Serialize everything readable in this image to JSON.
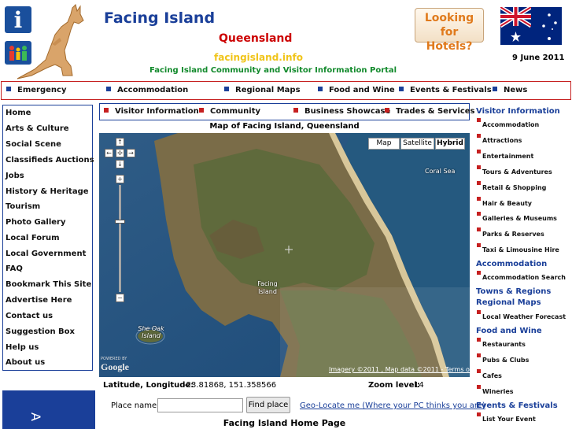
{
  "header": {
    "title": "Facing Island",
    "state": "Queensland",
    "domain": "facingisland.info",
    "portal": "Facing Island Community and Visitor Information Portal",
    "hotels_line1": "Looking for",
    "hotels_line2": "Hotels?",
    "date": "9 June 2011"
  },
  "topnav": [
    "Emergency",
    "Accommodation",
    "Regional Maps",
    "Food and Wine",
    "Events & Festivals",
    "News"
  ],
  "leftnav": [
    "Home",
    "Arts & Culture",
    "Social Scene",
    "Classifieds Auctions",
    "Jobs",
    "History & Heritage",
    "Tourism",
    "Photo Gallery",
    "Local Forum",
    "Local Government",
    "FAQ",
    "Bookmark This Site",
    "Advertise Here",
    "Contact us",
    "Suggestion Box",
    "Help us",
    "About us"
  ],
  "subnav": [
    "Visitor Information",
    "Community",
    "Business Showcase",
    "Trades & Services"
  ],
  "map": {
    "title": "Map of Facing Island, Queensland",
    "types": [
      "Map",
      "Satellite",
      "Hybrid"
    ],
    "selected_type": "Hybrid",
    "labels": {
      "coral_sea": "Coral Sea",
      "facing_island_1": "Facing",
      "facing_island_2": "Island",
      "she_oak_1": "She Oak",
      "she_oak_2": "Island"
    },
    "powered_by": "POWERED BY",
    "google": "Google",
    "attribution": "Imagery ©2011 , Map data ©2011 - Terms of Use"
  },
  "location": {
    "coords_label": "Latitude, Longitude:",
    "coords_value": "-23.81868, 151.358566",
    "zoom_label": "Zoom level:",
    "zoom_value": "14"
  },
  "search": {
    "place_label": "Place name:",
    "place_value": "",
    "find_label": "Find place",
    "geolocate_label": "Geo-Locate me (Where your PC thinks you are)"
  },
  "home_title": "Facing Island Home Page",
  "side_panel_text": "A",
  "rightcol": {
    "visitor_info": "Visitor Information",
    "visitor_items": [
      "Accommodation",
      "Attractions",
      "Entertainment",
      "Tours & Adventures",
      "Retail & Shopping",
      "Hair & Beauty",
      "Galleries & Museums",
      "Parks & Reserves",
      "Taxi & Limousine Hire"
    ],
    "accommodation": "Accommodation",
    "accommodation_items": [
      "Accommodation Search"
    ],
    "towns": "Towns & Regions",
    "regional_maps": "Regional Maps",
    "regional_items": [
      "Local Weather Forecast"
    ],
    "food": "Food and Wine",
    "food_items": [
      "Restaurants",
      "Pubs & Clubs",
      "Cafes",
      "Wineries"
    ],
    "events": "Events & Festivals",
    "events_items": [
      "List Your Event"
    ]
  },
  "colors": {
    "brand_blue": "#1a3f99",
    "accent_red": "#c62020",
    "portal_green": "#128a2c",
    "domain_yellow": "#f0c419",
    "hotels_orange": "#e07a1c"
  }
}
